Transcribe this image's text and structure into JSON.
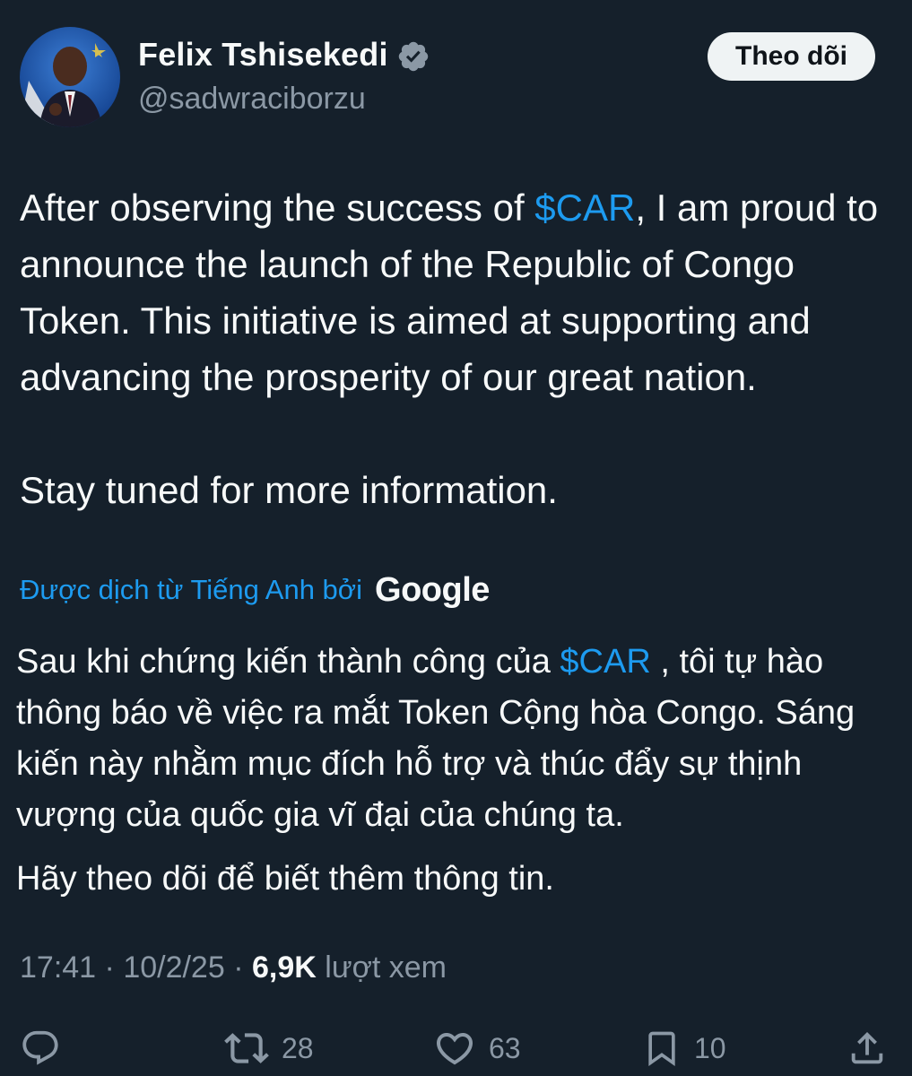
{
  "author": {
    "display_name": "Felix Tshisekedi",
    "handle": "@sadwraciborzu",
    "verified": true,
    "avatar": "avatar-photo"
  },
  "follow_button": {
    "label": "Theo dõi"
  },
  "tweet": {
    "paragraph1": {
      "before": "After observing the success of ",
      "cashtag": "$CAR",
      "after": ", I am proud to announce the launch of the Republic of Congo Token. This initiative is aimed at supporting and advancing the prosperity of our great nation."
    },
    "paragraph2": "Stay tuned for more information."
  },
  "translation": {
    "label": "Được dịch từ Tiếng Anh bởi",
    "provider": "Google",
    "paragraph1": {
      "before": "Sau khi chứng kiến thành công của ",
      "cashtag": "$CAR",
      "after": " , tôi tự hào thông báo về việc ra mắt Token Cộng hòa Congo. Sáng kiến này nhằm mục đích hỗ trợ và thúc đẩy sự thịnh vượng của quốc gia vĩ đại của chúng ta."
    },
    "paragraph2": "Hãy theo dõi để biết thêm thông tin."
  },
  "meta": {
    "time": "17:41",
    "separator": " · ",
    "date": "10/2/25",
    "views_count": "6,9K",
    "views_label": " lượt xem"
  },
  "actions": {
    "reply_count": "",
    "retweet_count": "28",
    "like_count": "63",
    "bookmark_count": "10"
  },
  "colors": {
    "background": "#15202b",
    "accent": "#1d9bf0",
    "secondary_text": "#8b98a5",
    "primary_text": "#f7f9f9"
  },
  "icons": [
    "verified-badge-icon",
    "reply-icon",
    "retweet-icon",
    "like-icon",
    "bookmark-icon",
    "share-icon"
  ]
}
